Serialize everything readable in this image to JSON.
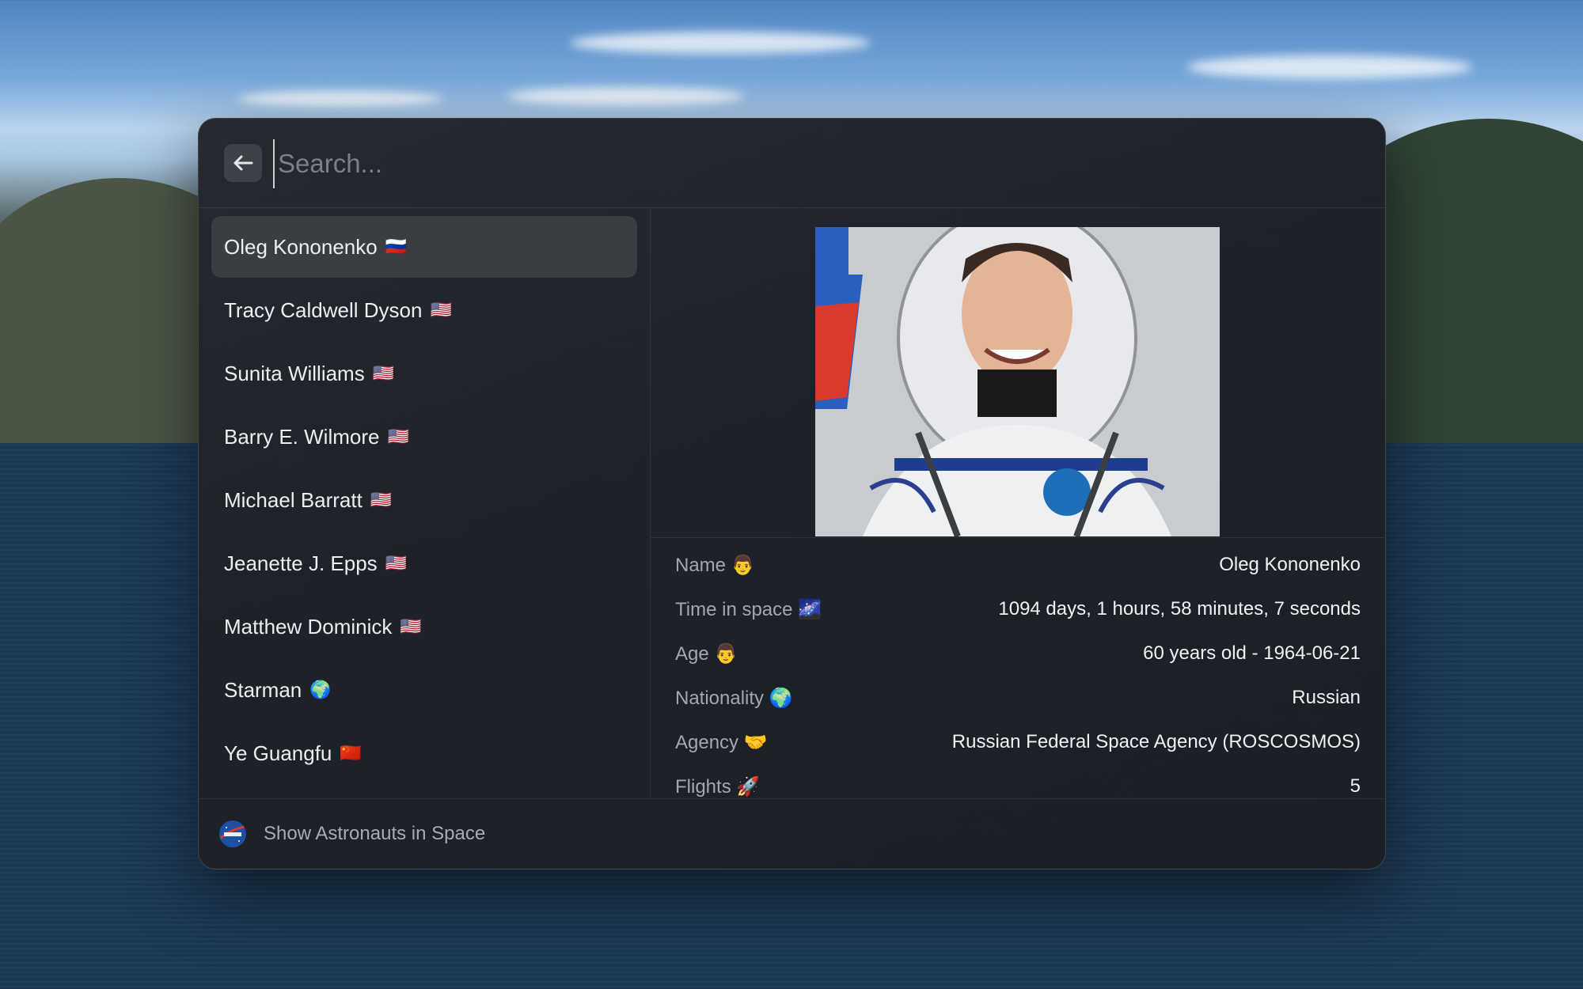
{
  "search": {
    "placeholder": "Search..."
  },
  "astronauts": [
    {
      "name": "Oleg Kononenko",
      "flag": "🇷🇺",
      "selected": true
    },
    {
      "name": "Tracy Caldwell Dyson",
      "flag": "🇺🇸"
    },
    {
      "name": "Sunita Williams",
      "flag": "🇺🇸"
    },
    {
      "name": "Barry E. Wilmore",
      "flag": "🇺🇸"
    },
    {
      "name": "Michael Barratt",
      "flag": "🇺🇸"
    },
    {
      "name": "Jeanette J. Epps",
      "flag": "🇺🇸"
    },
    {
      "name": "Matthew Dominick",
      "flag": "🇺🇸"
    },
    {
      "name": "Starman",
      "flag": "🌍"
    },
    {
      "name": "Ye Guangfu",
      "flag": "🇨🇳"
    }
  ],
  "detail": {
    "rows": [
      {
        "label": "Name 👨",
        "value": "Oleg Kononenko"
      },
      {
        "label": "Time in space 🌌",
        "value": "1094 days, 1 hours, 58 minutes, 7 seconds"
      },
      {
        "label": "Age 👨",
        "value": "60 years old - 1964-06-21"
      },
      {
        "label": "Nationality 🌍",
        "value": "Russian"
      },
      {
        "label": "Agency 🤝",
        "value": "Russian Federal Space Agency (ROSCOSMOS)"
      },
      {
        "label": "Flights 🚀",
        "value": "5"
      }
    ]
  },
  "footer": {
    "title": "Show Astronauts in Space",
    "icon": "nasa-logo-icon"
  },
  "colors": {
    "window_bg": "#1e2228",
    "selected_bg": "#3a3d42",
    "accent_blue": "#1d4fa3"
  }
}
